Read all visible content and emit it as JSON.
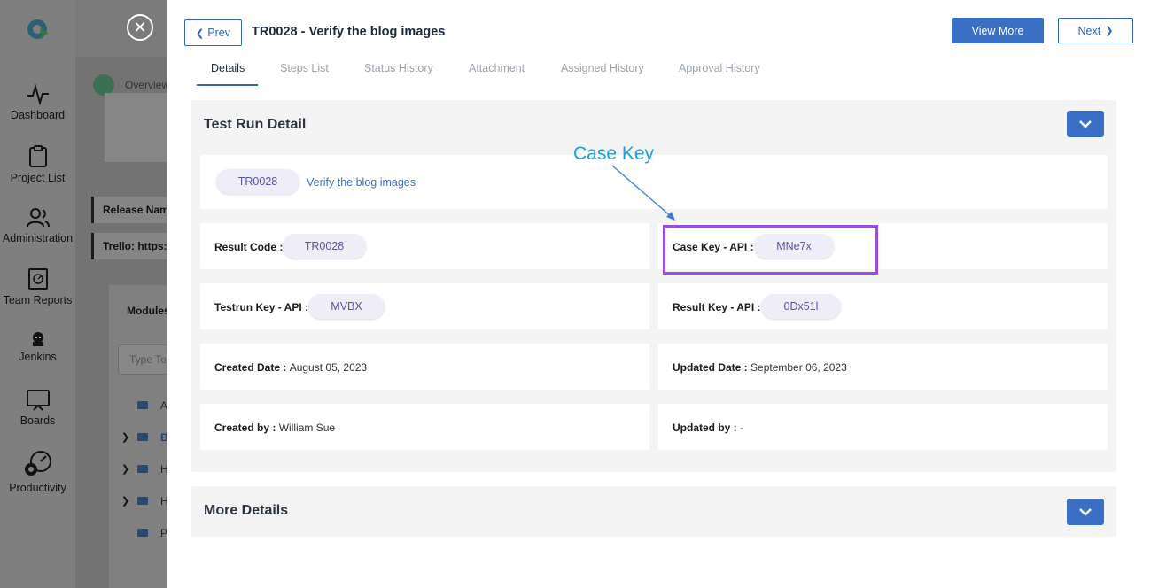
{
  "sidebar": {
    "items": [
      {
        "label": "Dashboard",
        "icon": "pulse-icon"
      },
      {
        "label": "Project List",
        "icon": "clipboard-icon"
      },
      {
        "label": "Administration",
        "icon": "users-icon"
      },
      {
        "label": "Team Reports",
        "icon": "report-icon"
      },
      {
        "label": "Jenkins",
        "icon": "jenkins-icon"
      },
      {
        "label": "Boards",
        "icon": "board-icon"
      },
      {
        "label": "Productivity",
        "icon": "productivity-icon"
      }
    ]
  },
  "background": {
    "overview": "Overview",
    "release_name": "Release Nam",
    "trello": "Trello: https:/",
    "modules": "Modules",
    "search_placeholder": "Type To",
    "folders": [
      "A",
      "B",
      "H",
      "H",
      "P"
    ]
  },
  "modal": {
    "prev_label": "Prev",
    "title": "TR0028 - Verify the blog images",
    "view_more_label": "View More",
    "next_label": "Next",
    "tabs": [
      {
        "label": "Details",
        "active": true
      },
      {
        "label": "Steps List",
        "active": false
      },
      {
        "label": "Status History",
        "active": false
      },
      {
        "label": "Attachment",
        "active": false
      },
      {
        "label": "Assigned History",
        "active": false
      },
      {
        "label": "Approval History",
        "active": false
      }
    ],
    "test_run_detail": {
      "heading": "Test Run Detail",
      "id_pill": "TR0028",
      "case_title": "Verify the blog images",
      "fields": {
        "result_code_label": "Result Code :",
        "result_code": "TR0028",
        "case_key_label": "Case Key - API :",
        "case_key": "MNe7x",
        "testrun_key_label": "Testrun Key - API :",
        "testrun_key": "MVBX",
        "result_key_label": "Result Key - API :",
        "result_key": "0Dx51l",
        "created_date_label": "Created Date :",
        "created_date": "August 05, 2023",
        "updated_date_label": "Updated Date :",
        "updated_date": "September 06, 2023",
        "created_by_label": "Created by :",
        "created_by": "William Sue",
        "updated_by_label": "Updated by :",
        "updated_by": "-"
      }
    },
    "more_details": {
      "heading": "More Details"
    }
  },
  "annotation": {
    "label": "Case Key",
    "color": "#1aa0dc",
    "box_color": "#9b4de0"
  },
  "colors": {
    "accent": "#3a6fc4",
    "pill_text": "#5b55a8"
  }
}
